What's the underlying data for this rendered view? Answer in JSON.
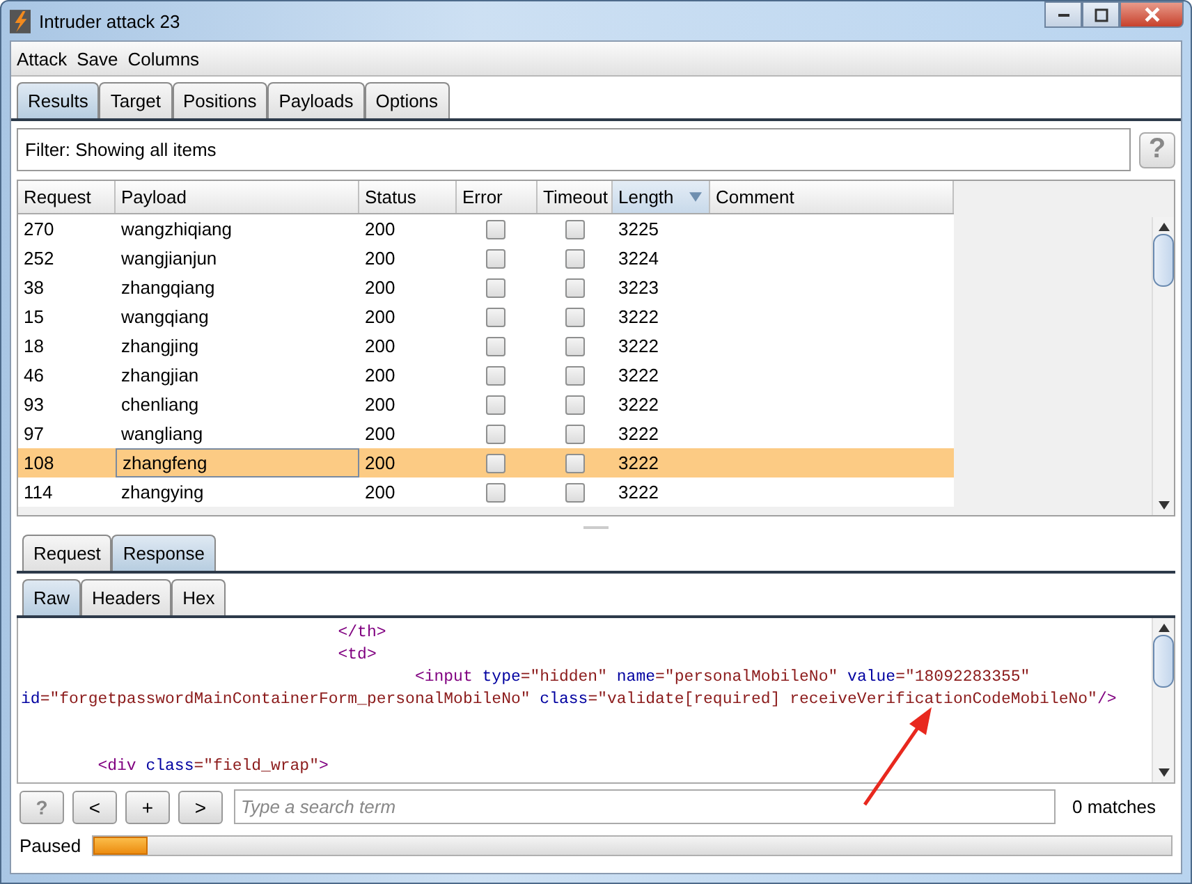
{
  "window": {
    "title": "Intruder attack 23"
  },
  "menu": [
    "Attack",
    "Save",
    "Columns"
  ],
  "tabs": [
    {
      "label": "Results",
      "selected": true
    },
    {
      "label": "Target",
      "selected": false
    },
    {
      "label": "Positions",
      "selected": false
    },
    {
      "label": "Payloads",
      "selected": false
    },
    {
      "label": "Options",
      "selected": false
    }
  ],
  "filter": {
    "label": "Filter: Showing all items",
    "help": "?"
  },
  "table": {
    "columns": [
      {
        "label": "Request",
        "sorted": false
      },
      {
        "label": "Payload",
        "sorted": false
      },
      {
        "label": "Status",
        "sorted": false
      },
      {
        "label": "Error",
        "sorted": false
      },
      {
        "label": "Timeout",
        "sorted": false
      },
      {
        "label": "Length",
        "sorted": true
      },
      {
        "label": "Comment",
        "sorted": false
      }
    ],
    "rows": [
      {
        "request": "270",
        "payload": "wangzhiqiang",
        "status": "200",
        "error": false,
        "timeout": false,
        "length": "3225",
        "selected": false
      },
      {
        "request": "252",
        "payload": "wangjianjun",
        "status": "200",
        "error": false,
        "timeout": false,
        "length": "3224",
        "selected": false
      },
      {
        "request": "38",
        "payload": "zhangqiang",
        "status": "200",
        "error": false,
        "timeout": false,
        "length": "3223",
        "selected": false
      },
      {
        "request": "15",
        "payload": "wangqiang",
        "status": "200",
        "error": false,
        "timeout": false,
        "length": "3222",
        "selected": false
      },
      {
        "request": "18",
        "payload": "zhangjing",
        "status": "200",
        "error": false,
        "timeout": false,
        "length": "3222",
        "selected": false
      },
      {
        "request": "46",
        "payload": "zhangjian",
        "status": "200",
        "error": false,
        "timeout": false,
        "length": "3222",
        "selected": false
      },
      {
        "request": "93",
        "payload": "chenliang",
        "status": "200",
        "error": false,
        "timeout": false,
        "length": "3222",
        "selected": false
      },
      {
        "request": "97",
        "payload": "wangliang",
        "status": "200",
        "error": false,
        "timeout": false,
        "length": "3222",
        "selected": false
      },
      {
        "request": "108",
        "payload": "zhangfeng",
        "status": "200",
        "error": false,
        "timeout": false,
        "length": "3222",
        "selected": true
      },
      {
        "request": "114",
        "payload": "zhangying",
        "status": "200",
        "error": false,
        "timeout": false,
        "length": "3222",
        "selected": false
      }
    ]
  },
  "message_tabs": [
    {
      "label": "Request",
      "selected": false
    },
    {
      "label": "Response",
      "selected": true
    }
  ],
  "view_tabs": [
    {
      "label": "Raw",
      "selected": true
    },
    {
      "label": "Headers",
      "selected": false
    },
    {
      "label": "Hex",
      "selected": false
    }
  ],
  "code": [
    {
      "kind": "line",
      "tokens": [
        {
          "kind": "tag",
          "text": "                                 </th>"
        }
      ]
    },
    {
      "kind": "line",
      "tokens": [
        {
          "kind": "tag",
          "text": "                                 <td>"
        }
      ]
    },
    {
      "kind": "line",
      "tokens": [
        {
          "kind": "tag",
          "text": "                                         <input"
        },
        {
          "kind": "attr",
          "text": " type"
        },
        {
          "kind": "value",
          "text": "=\"hidden\""
        },
        {
          "kind": "attr",
          "text": " name"
        },
        {
          "kind": "value",
          "text": "=\"personalMobileNo\""
        },
        {
          "kind": "attr",
          "text": " value"
        },
        {
          "kind": "value",
          "text": "=\"18092283355\""
        }
      ]
    },
    {
      "kind": "line",
      "tokens": [
        {
          "kind": "attr",
          "text": "id"
        },
        {
          "kind": "value",
          "text": "=\"forgetpasswordMainContainerForm_personalMobileNo\""
        },
        {
          "kind": "attr",
          "text": " class"
        },
        {
          "kind": "value",
          "text": "=\"validate[required] receiveVerificationCodeMobileNo\""
        },
        {
          "kind": "tag",
          "text": "/>"
        }
      ]
    },
    {
      "kind": "spaced",
      "tokens": [
        {
          "kind": "tag",
          "text": "        <div"
        },
        {
          "kind": "attr",
          "text": " class"
        },
        {
          "kind": "value",
          "text": "=\"field_wrap\""
        },
        {
          "kind": "tag",
          "text": ">"
        }
      ]
    }
  ],
  "search": {
    "buttons": [
      "?",
      "<",
      "+",
      ">"
    ],
    "placeholder": "Type a search term",
    "matches": "0 matches"
  },
  "status": {
    "label": "Paused",
    "level": 0.05
  }
}
